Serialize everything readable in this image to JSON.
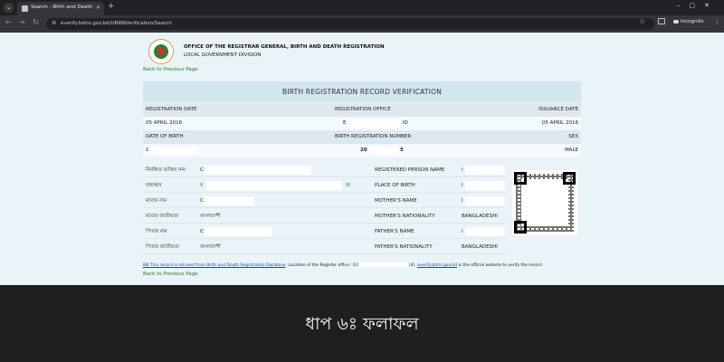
{
  "browser": {
    "tab_title": "Search - Birth and Death Verific",
    "url": "everify.bdris.gov.bd/UBRNVerification/Search",
    "incognito_label": "Incognito"
  },
  "header": {
    "office_title": "OFFICE OF THE REGISTRAR GENERAL, BIRTH AND DEATH REGISTRATION",
    "office_sub": "LOCAL GOVERNMENT DIVISION",
    "back_link": "Back to Previous Page"
  },
  "banner": "BIRTH REGISTRATION RECORD VERIFICATION",
  "record": {
    "h1": {
      "a": "REGISTRATION DATE",
      "b": "REGISTRATION OFFICE",
      "c": "ISSUANCE DATE"
    },
    "r1": {
      "a": "05 APRIL 2016",
      "b_prefix": "E",
      "b_suffix": "ID",
      "c": "05 APRIL 2016"
    },
    "h2": {
      "a": "DATE OF BIRTH",
      "b": "BIRTH REGISTRATION NUMBER",
      "c": "SEX"
    },
    "r2": {
      "a": "1",
      "b_prefix": "20",
      "b_suffix": "5",
      "c": "MALE"
    }
  },
  "person": [
    {
      "bn_label": "নিবন্ধিত ব্যক্তির নাম",
      "bn_value": "C",
      "en_label": "REGISTERED PERSON NAME",
      "en_value": "I"
    },
    {
      "bn_label": "জন্মস্থান",
      "bn_value": "ব",
      "bn_value_end": "য়া",
      "en_label": "PLACE OF BIRTH",
      "en_value": "I"
    },
    {
      "bn_label": "মাতার নাম",
      "bn_value": "C",
      "en_label": "MOTHER'S NAME",
      "en_value": "I"
    },
    {
      "bn_label": "মাতার জাতীয়তা",
      "bn_value": "বাংলাদেশী",
      "en_label": "MOTHER'S NATIONALITY",
      "en_value": "BANGLADESHI"
    },
    {
      "bn_label": "পিতার নাম",
      "bn_value": "C",
      "en_label": "FATHER'S NAME",
      "en_value": "I"
    },
    {
      "bn_label": "পিতার জাতীয়তা",
      "bn_value": "বাংলাদেশী",
      "en_label": "FATHER'S NATIONALITY",
      "en_value": "BANGLADESHI"
    }
  ],
  "note": {
    "link_part": "NB This record is retrived from Birth and Death Registration Database",
    "middle": ". Location of the Register office : ",
    "office": "E/I",
    "office_end": "(4). ",
    "site": "everify.bdris.gov.bd",
    "end": " is the official website to verify the record"
  },
  "caption": "ধাপ ৬ঃ ফলাফল",
  "colors": {
    "page_bg": "#eaf3f7",
    "banner_bg": "#d3e6ef",
    "link_green": "#2a7a2a",
    "caption_bg": "#1f1f1f"
  }
}
